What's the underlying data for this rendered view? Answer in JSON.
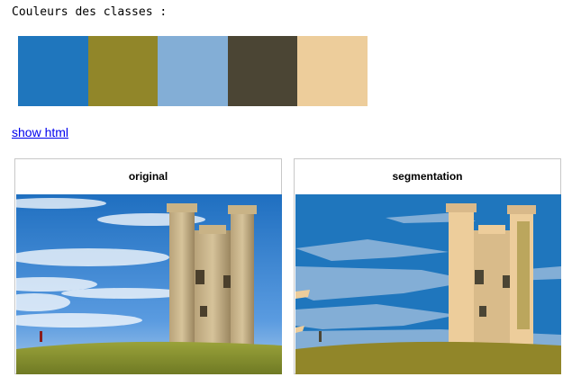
{
  "heading": "Couleurs des classes :",
  "palette": {
    "colors": [
      "#1f76bd",
      "#918629",
      "#83aed6",
      "#4b4534",
      "#edcd9b"
    ]
  },
  "link": {
    "label": "show html"
  },
  "panels": [
    {
      "title": "original"
    },
    {
      "title": "segmentation"
    }
  ]
}
